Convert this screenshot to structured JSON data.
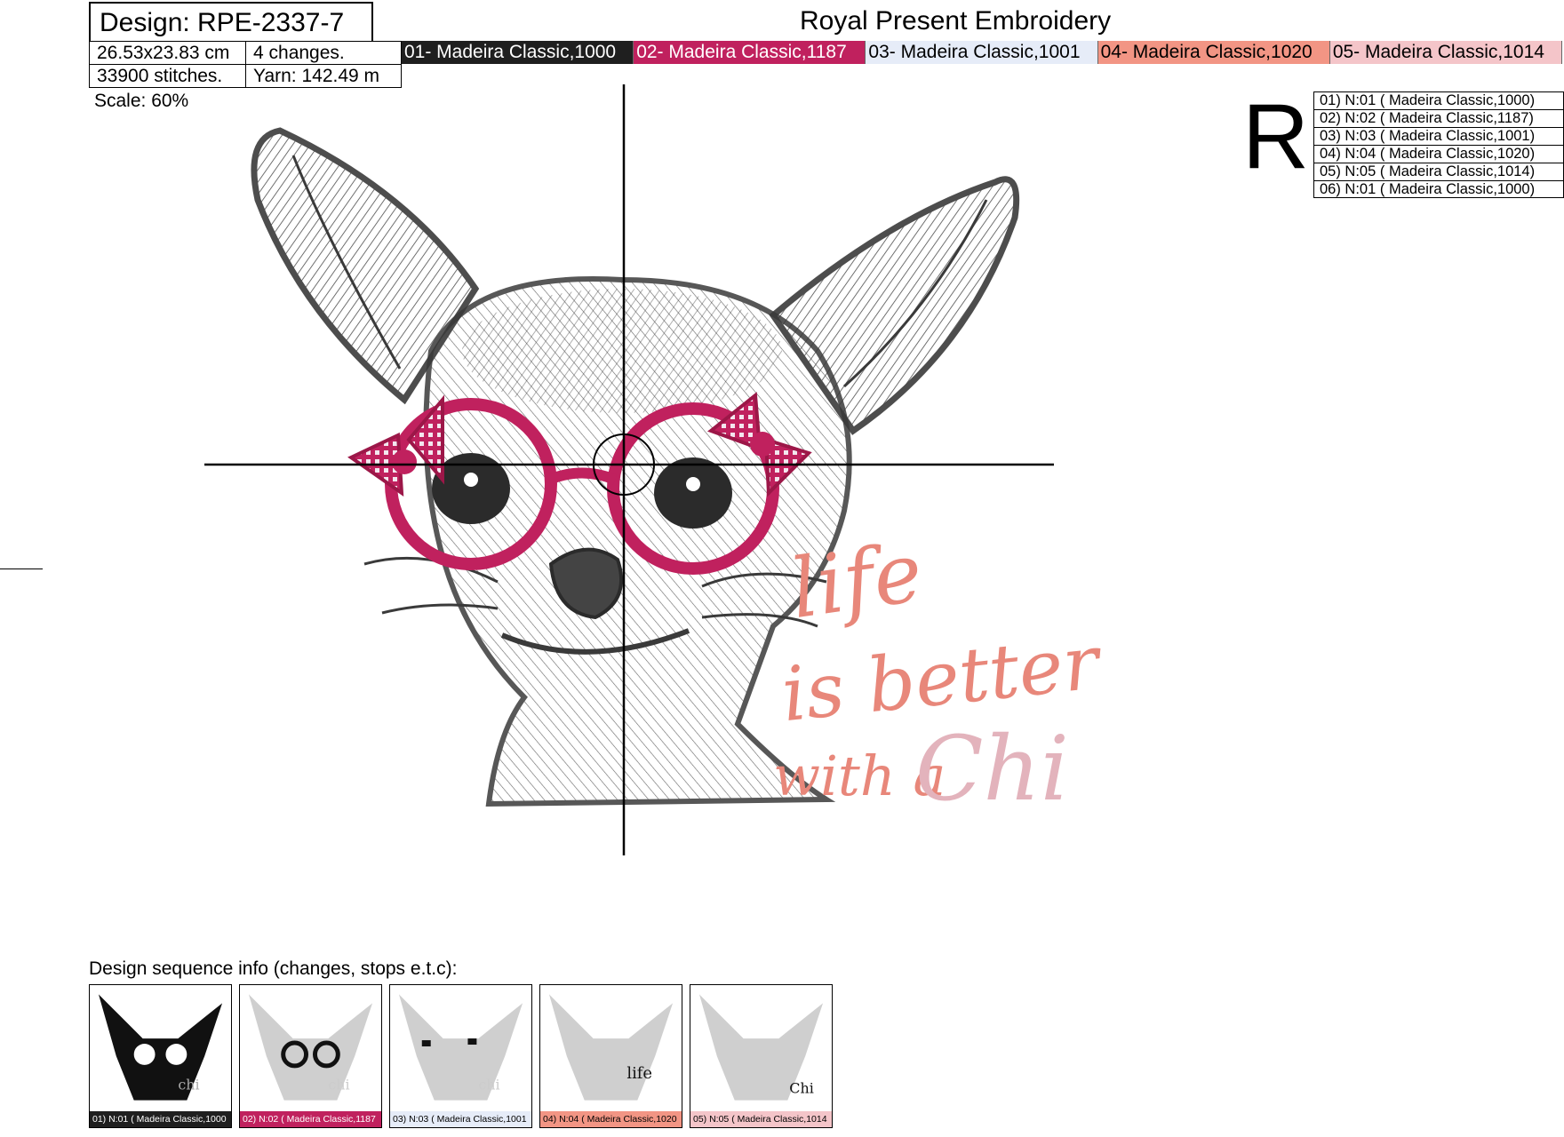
{
  "header": {
    "design": "Design: RPE-2337-7",
    "brand": "Royal Present Embroidery",
    "size": "26.53x23.83 cm",
    "changes": "4 changes.",
    "stitches": "33900 stitches.",
    "yarn": "Yarn: 142.49 m",
    "scale": "Scale: 60%"
  },
  "threads": [
    {
      "label": "01- Madeira Classic,1000",
      "bg": "#1f1f1f",
      "fg": "#ffffff"
    },
    {
      "label": "02- Madeira Classic,1187",
      "bg": "#c0215e",
      "fg": "#ffffff"
    },
    {
      "label": "03- Madeira Classic,1001",
      "bg": "#e6ecf8",
      "fg": "#000000"
    },
    {
      "label": "04- Madeira Classic,1020",
      "bg": "#f29584",
      "fg": "#000000"
    },
    {
      "label": "05- Madeira Classic,1014",
      "bg": "#f4c5c9",
      "fg": "#000000"
    }
  ],
  "rotate_mark": "R",
  "stop_sequence": [
    "01) N:01 ( Madeira Classic,1000)",
    "02) N:02 ( Madeira Classic,1187)",
    "03) N:03 ( Madeira Classic,1001)",
    "04) N:04 ( Madeira Classic,1020)",
    "05) N:05 ( Madeira Classic,1014)",
    "06) N:01 ( Madeira Classic,1000)"
  ],
  "design_text": {
    "line1": "life",
    "line2": "is better",
    "line3": "with a",
    "line4": "Chi"
  },
  "sequence_label": "Design sequence info (changes, stops e.t.c):",
  "sequence_cards": [
    {
      "caption": "01) N:01 ( Madeira Classic,1000",
      "bg": "#1f1f1f",
      "fg": "#ffffff"
    },
    {
      "caption": "02) N:02 ( Madeira Classic,1187",
      "bg": "#c0215e",
      "fg": "#ffffff"
    },
    {
      "caption": "03) N:03 ( Madeira Classic,1001",
      "bg": "#e6ecf8",
      "fg": "#000000"
    },
    {
      "caption": "04) N:04 ( Madeira Classic,1020",
      "bg": "#f29584",
      "fg": "#000000"
    },
    {
      "caption": "05) N:05 ( Madeira Classic,1014",
      "bg": "#f4c5c9",
      "fg": "#000000"
    }
  ],
  "colors": {
    "sketch": "#3a3a3a",
    "glasses": "#c0215e",
    "text_salmon": "#e8877a",
    "text_pink": "#e3b3bc"
  }
}
